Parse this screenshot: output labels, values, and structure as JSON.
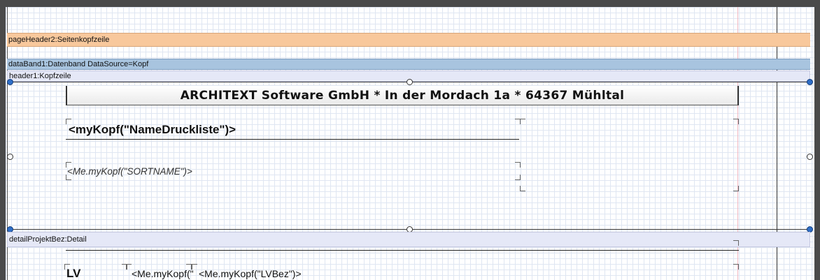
{
  "bands": {
    "page_header": "pageHeader2:Seitenkopfzeile",
    "data_band": "dataBand1:Datenband DataSource=Kopf",
    "header": "header1:Kopfzeile",
    "detail": "detailProjektBez:Detail"
  },
  "fields": {
    "company_title": "ARCHITEXT Software GmbH * In der Mordach 1a * 64367 Mühltal",
    "name_druckliste": "<myKopf(\"NameDruckliste\")>",
    "sortname": "<Me.myKopf(\"SORTNAME\")>",
    "lv_label": "LV",
    "lv_key": "<Me.myKopf(\"",
    "lv_bez": "<Me.myKopf(\"LVBez\")>"
  },
  "colors": {
    "page_header_band": "#f8c89c",
    "data_band": "#a8c4df",
    "header_band": "#e5e8f7",
    "selection_handle": "#2f6fc8",
    "margin_line": "#f2b9c3"
  }
}
